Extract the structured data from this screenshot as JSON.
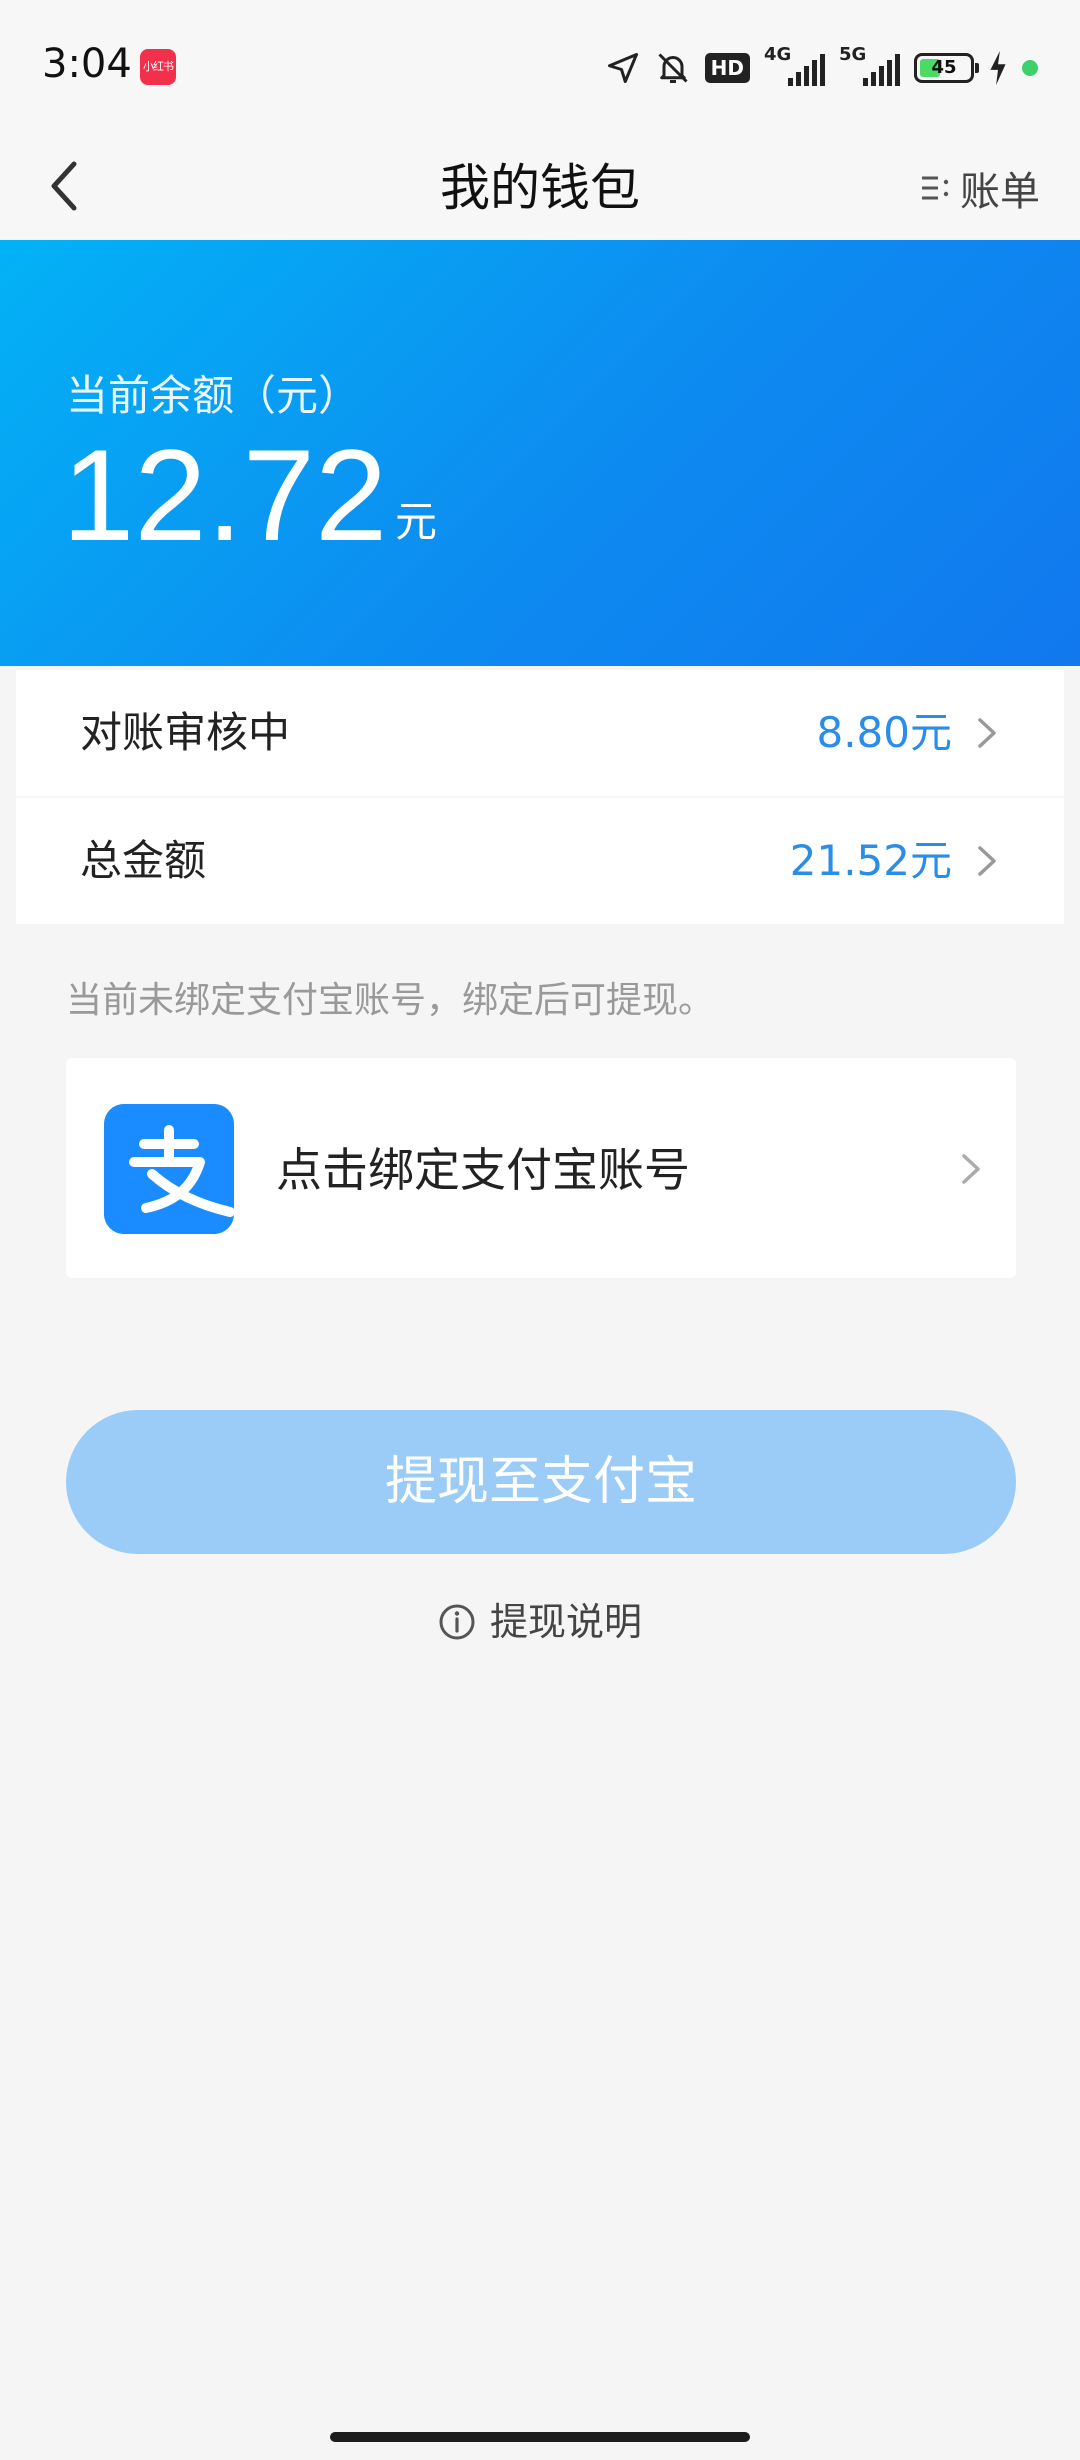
{
  "status_bar": {
    "time": "3:04",
    "app_badge": "小红书",
    "hd_label": "HD",
    "net1": "4G",
    "net2": "5G",
    "battery": "45"
  },
  "nav": {
    "title": "我的钱包",
    "bill_label": "账单"
  },
  "balance": {
    "label": "当前余额（元）",
    "amount": "12.72",
    "unit": "元"
  },
  "rows": [
    {
      "label": "对账审核中",
      "value": "8.80元"
    },
    {
      "label": "总金额",
      "value": "21.52元"
    }
  ],
  "hint": "当前未绑定支付宝账号，绑定后可提现。",
  "bind": {
    "logo_char": "支",
    "text": "点击绑定支付宝账号"
  },
  "withdraw_button": "提现至支付宝",
  "info_link": "提现说明",
  "colors": {
    "accent_blue": "#1389ef",
    "value_blue": "#2a8ee8",
    "button_disabled": "#9bccf7",
    "alipay_blue": "#1677ff"
  }
}
